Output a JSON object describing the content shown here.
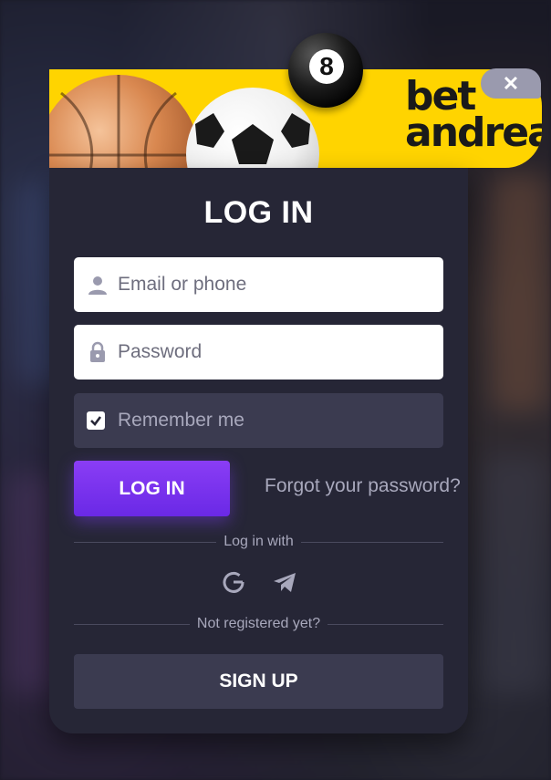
{
  "brand": {
    "line1": "bet",
    "line2": "andreas",
    "eight_ball_number": "8"
  },
  "close_label": "✕",
  "form": {
    "title": "LOG IN",
    "email_placeholder": "Email or phone",
    "password_placeholder": "Password",
    "remember_label": "Remember me",
    "remember_checked": true,
    "login_button": "LOG IN",
    "forgot_link": "Forgot your password?",
    "login_with": "Log in with",
    "socials": [
      "google-icon",
      "telegram-icon"
    ],
    "not_registered": "Not registered yet?",
    "signup_button": "SIGN UP"
  },
  "colors": {
    "banner_yellow": "#ffd400",
    "card_bg": "#262636",
    "accent_purple": "#7a33ee",
    "muted_field": "#3b3b50"
  }
}
